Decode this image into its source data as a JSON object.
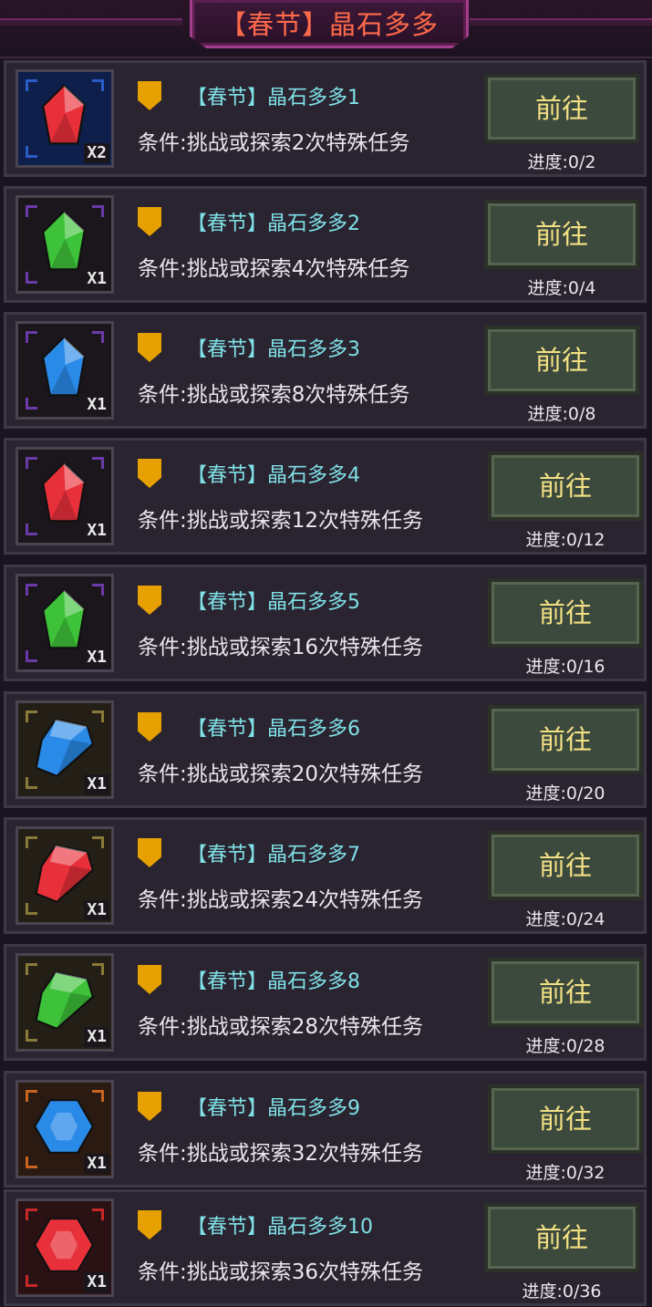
{
  "header": {
    "title": "【春节】晶石多多"
  },
  "tasks": [
    {
      "name": "【春节】晶石多多1",
      "condition": "条件:挑战或探索2次特殊任务",
      "button": "前往",
      "progress": "进度:0/2",
      "qty": "X2",
      "gem": "red-crystal-gem-icon",
      "gem_color": "#e8303a",
      "frame_color": "#2a5cc8",
      "bg": "#0d1f4a"
    },
    {
      "name": "【春节】晶石多多2",
      "condition": "条件:挑战或探索4次特殊任务",
      "button": "前往",
      "progress": "进度:0/4",
      "qty": "X1",
      "gem": "green-crystal-gem-icon",
      "gem_color": "#3ec23a",
      "frame_color": "#6a3aa8",
      "bg": "#1a161c"
    },
    {
      "name": "【春节】晶石多多3",
      "condition": "条件:挑战或探索8次特殊任务",
      "button": "前往",
      "progress": "进度:0/8",
      "qty": "X1",
      "gem": "blue-crystal-gem-icon",
      "gem_color": "#2a8ae8",
      "frame_color": "#6a3aa8",
      "bg": "#1a161c"
    },
    {
      "name": "【春节】晶石多多4",
      "condition": "条件:挑战或探索12次特殊任务",
      "button": "前往",
      "progress": "进度:0/12",
      "qty": "X1",
      "gem": "red-crystal-gem-icon",
      "gem_color": "#e8303a",
      "frame_color": "#6a3aa8",
      "bg": "#1a161c"
    },
    {
      "name": "【春节】晶石多多5",
      "condition": "条件:挑战或探索16次特殊任务",
      "button": "前往",
      "progress": "进度:0/16",
      "qty": "X1",
      "gem": "green-crystal-gem-icon",
      "gem_color": "#3ec23a",
      "frame_color": "#6a3aa8",
      "bg": "#1a161c"
    },
    {
      "name": "【春节】晶石多多6",
      "condition": "条件:挑战或探索20次特殊任务",
      "button": "前往",
      "progress": "进度:0/20",
      "qty": "X1",
      "gem": "blue-cut-gem-icon",
      "gem_color": "#2a8ae8",
      "frame_color": "#8a7a3a",
      "bg": "#241f16"
    },
    {
      "name": "【春节】晶石多多7",
      "condition": "条件:挑战或探索24次特殊任务",
      "button": "前往",
      "progress": "进度:0/24",
      "qty": "X1",
      "gem": "red-cut-gem-icon",
      "gem_color": "#e8303a",
      "frame_color": "#8a7a3a",
      "bg": "#241f16"
    },
    {
      "name": "【春节】晶石多多8",
      "condition": "条件:挑战或探索28次特殊任务",
      "button": "前往",
      "progress": "进度:0/28",
      "qty": "X1",
      "gem": "green-cut-gem-icon",
      "gem_color": "#3ec23a",
      "frame_color": "#8a7a3a",
      "bg": "#241f16"
    },
    {
      "name": "【春节】晶石多多9",
      "condition": "条件:挑战或探索32次特殊任务",
      "button": "前往",
      "progress": "进度:0/32",
      "qty": "X1",
      "gem": "blue-hexagon-gem-icon",
      "gem_color": "#2a8ae8",
      "frame_color": "#c8641e",
      "bg": "#2a1a12"
    },
    {
      "name": "【春节】晶石多多10",
      "condition": "条件:挑战或探索36次特殊任务",
      "button": "前往",
      "progress": "进度:0/36",
      "qty": "X1",
      "gem": "red-hexagon-gem-icon",
      "gem_color": "#e8303a",
      "frame_color": "#c82828",
      "bg": "#2a1214"
    }
  ]
}
